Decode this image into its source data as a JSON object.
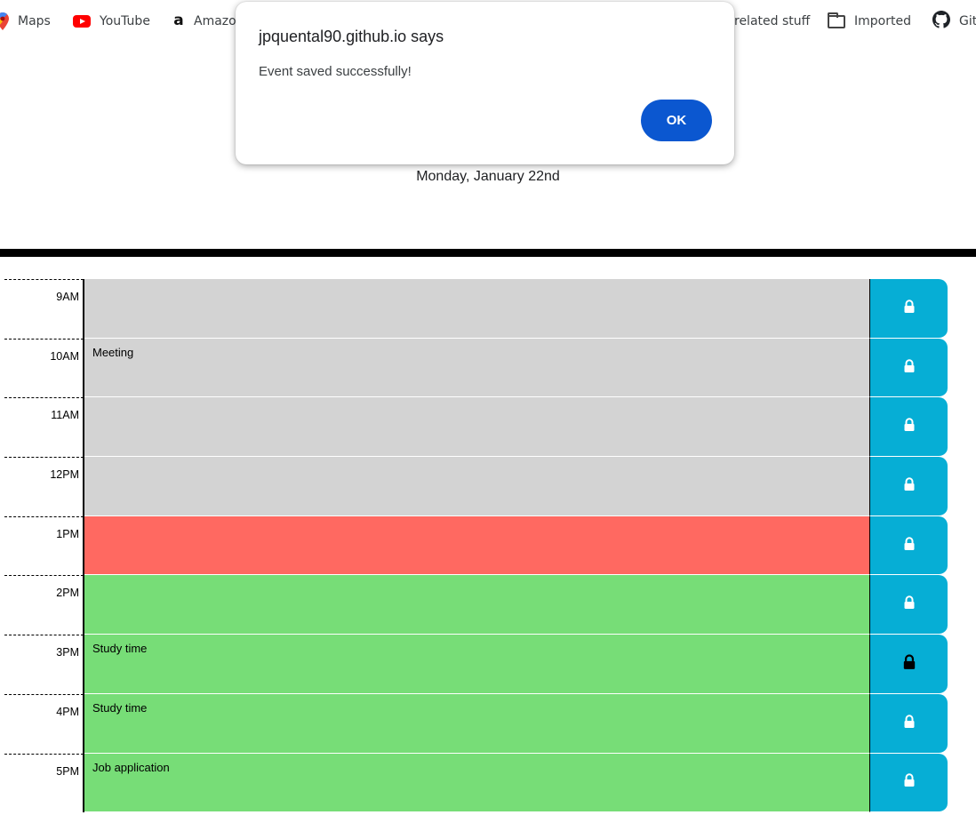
{
  "bookmarks": [
    {
      "label": "Maps",
      "icon": "maps-icon"
    },
    {
      "label": "YouTube",
      "icon": "youtube-icon"
    },
    {
      "label": "Amazo",
      "icon": "amazon-icon"
    },
    {
      "label": "related stuff",
      "icon": "folder-icon"
    },
    {
      "label": "Imported",
      "icon": "folder-icon"
    },
    {
      "label": "Git",
      "icon": "github-icon"
    }
  ],
  "header": {
    "date": "Monday, January 22nd"
  },
  "dialog": {
    "title": "jpquental90.github.io says",
    "message": "Event saved successfully!",
    "ok_label": "OK"
  },
  "colors": {
    "past": "#d3d3d3",
    "present": "#ff6961",
    "future": "#77dd77",
    "save": "#06aed5",
    "ok_button": "#0b57d0"
  },
  "hours": [
    {
      "label": "9AM",
      "event": "",
      "status": "past"
    },
    {
      "label": "10AM",
      "event": "Meeting",
      "status": "past"
    },
    {
      "label": "11AM",
      "event": "",
      "status": "past"
    },
    {
      "label": "12PM",
      "event": "",
      "status": "past"
    },
    {
      "label": "1PM",
      "event": "",
      "status": "present"
    },
    {
      "label": "2PM",
      "event": "",
      "status": "future"
    },
    {
      "label": "3PM",
      "event": "Study time",
      "status": "future"
    },
    {
      "label": "4PM",
      "event": "Study time",
      "status": "future"
    },
    {
      "label": "5PM",
      "event": "Job application",
      "status": "future"
    }
  ]
}
